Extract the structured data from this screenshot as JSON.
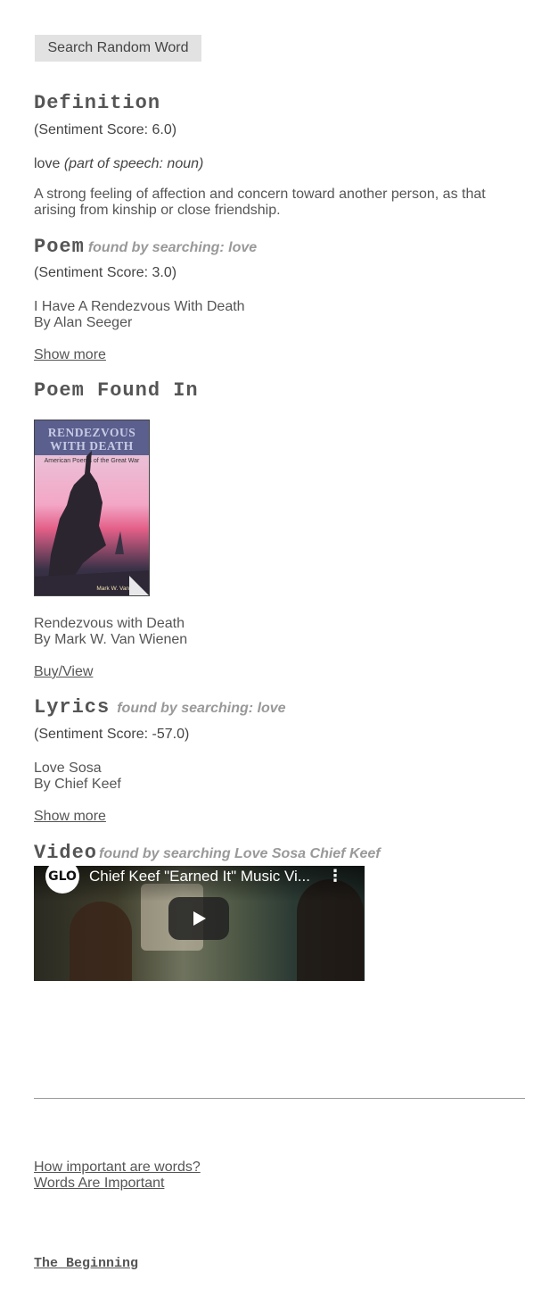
{
  "search_button": "Search Random Word",
  "definition": {
    "heading": "Definition",
    "score": "(Sentiment Score: 6.0)",
    "word": "love",
    "part_of_speech": "(part of speech: noun)",
    "text": "A strong feeling of affection and concern toward another person, as that arising from kinship or close friendship."
  },
  "poem": {
    "heading": "Poem",
    "found_by": "found by searching: love",
    "score": "(Sentiment Score: 3.0)",
    "title": "I Have A Rendezvous With Death",
    "author": "By Alan Seeger",
    "show_more": "Show more"
  },
  "poem_found_in": {
    "heading": "Poem Found In",
    "cover": {
      "title_line1": "RENDEZVOUS",
      "title_line2": "WITH DEATH",
      "subtitle": "American Poems of the Great War",
      "author": "Mark W. Van W"
    },
    "book_title": "Rendezvous with Death",
    "book_author": "By Mark W. Van Wienen",
    "buy_view": "Buy/View"
  },
  "lyrics": {
    "heading": "Lyrics",
    "found_by": "found by searching: love",
    "score": "(Sentiment Score: -57.0)",
    "title": "Love Sosa",
    "author": "By Chief Keef",
    "show_more": "Show more"
  },
  "video": {
    "heading": "Video",
    "found_by": "found by searching Love Sosa Chief Keef",
    "channel_badge": "GLO",
    "title": "Chief Keef \"Earned It\" Music Vi...",
    "menu_icon": "more-vert-icon",
    "play_icon": "play-icon"
  },
  "footer": {
    "link1": "How important are words?",
    "link2": "Words Are Important",
    "beginning": "The Beginning"
  }
}
